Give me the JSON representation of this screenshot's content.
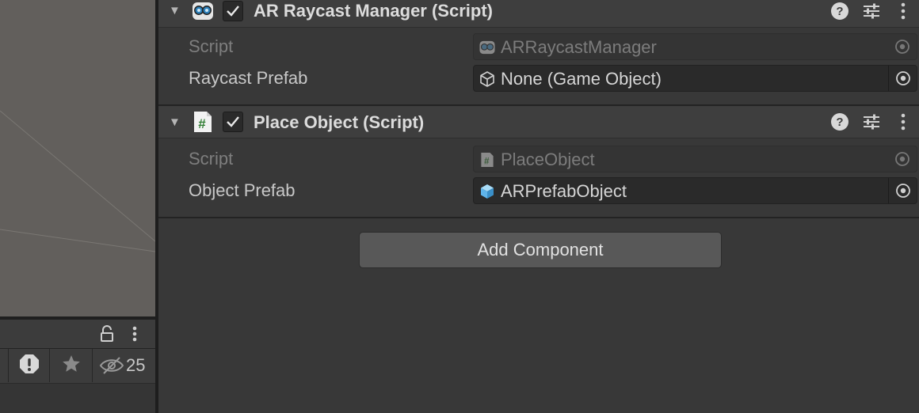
{
  "inspector": {
    "components": [
      {
        "title": "AR Raycast Manager (Script)",
        "icon": "script-robot-icon",
        "enabled": true,
        "properties": [
          {
            "label": "Script",
            "value": "ARRaycastManager",
            "field_icon": "script-robot-icon",
            "disabled": true
          },
          {
            "label": "Raycast Prefab",
            "value": "None (Game Object)",
            "field_icon": "gameobject-cube-icon",
            "disabled": false
          }
        ]
      },
      {
        "title": "Place Object (Script)",
        "icon": "csharp-script-icon",
        "enabled": true,
        "properties": [
          {
            "label": "Script",
            "value": "PlaceObject",
            "field_icon": "csharp-script-icon",
            "disabled": true
          },
          {
            "label": "Object Prefab",
            "value": "ARPrefabObject",
            "field_icon": "prefab-cube-icon",
            "disabled": false
          }
        ]
      }
    ],
    "add_component_label": "Add Component"
  },
  "left_panel": {
    "hidden_count": "25"
  },
  "colors": {
    "panel_bg": "#383838",
    "header_bg": "#3e3e3e",
    "field_bg": "#2a2a2a",
    "scene_bg": "#625f5c",
    "button_bg": "#585858",
    "prefab_blue": "#5fb4ea"
  }
}
